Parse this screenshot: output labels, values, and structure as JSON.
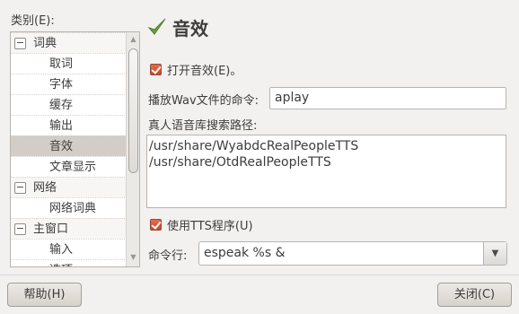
{
  "sidebar": {
    "label": "类别(E):",
    "items": [
      {
        "label": "词典",
        "kind": "group",
        "expander": "−"
      },
      {
        "label": "取词",
        "kind": "child"
      },
      {
        "label": "字体",
        "kind": "child"
      },
      {
        "label": "缓存",
        "kind": "child"
      },
      {
        "label": "输出",
        "kind": "child"
      },
      {
        "label": "音效",
        "kind": "child",
        "selected": true
      },
      {
        "label": "文章显示",
        "kind": "child"
      },
      {
        "label": "网络",
        "kind": "group",
        "expander": "−"
      },
      {
        "label": "网络词典",
        "kind": "child"
      },
      {
        "label": "主窗口",
        "kind": "group",
        "expander": "−"
      },
      {
        "label": "输入",
        "kind": "child"
      },
      {
        "label": "选项",
        "kind": "child"
      }
    ]
  },
  "page": {
    "title": "音效",
    "title_icon": "checkmark-icon"
  },
  "sound": {
    "enable_label": "打开音效(E)。",
    "enable_checked": true,
    "wav_cmd_label": "播放Wav文件的命令:",
    "wav_cmd_value": "aplay",
    "tts_path_label": "真人语音库搜索路径:",
    "tts_paths": [
      "/usr/share/WyabdcRealPeopleTTS",
      "/usr/share/OtdRealPeopleTTS"
    ],
    "use_tts_label": "使用TTS程序(U)",
    "use_tts_checked": true,
    "command_label": "命令行:",
    "command_value": "espeak %s &"
  },
  "buttons": {
    "help": "帮助(H)",
    "close": "关闭(C)"
  },
  "colors": {
    "accent_check": "#d9553a",
    "title_check_icon": "#6aa336",
    "selected_row": "#d2cdc7"
  }
}
